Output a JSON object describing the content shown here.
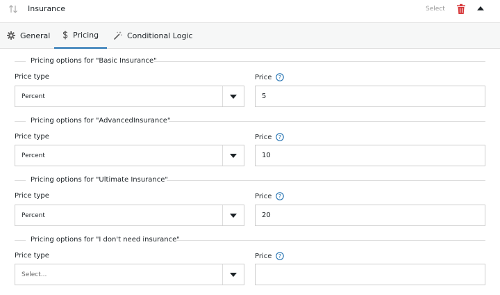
{
  "header": {
    "title": "Insurance",
    "select_label": "Select",
    "icons": {
      "drag": "sort-arrows-icon",
      "delete": "trash-icon",
      "collapse": "caret-up-icon"
    },
    "colors": {
      "delete": "#d63638"
    }
  },
  "tabs": [
    {
      "label": "General",
      "icon": "gear-icon",
      "active": false
    },
    {
      "label": "Pricing",
      "icon": "dollar-icon",
      "active": true
    },
    {
      "label": "Conditional Logic",
      "icon": "magic-wand-icon",
      "active": false
    }
  ],
  "colors": {
    "accent": "#2271b1",
    "tab_bar_bg": "#f6f7f7"
  },
  "pricing_sections": [
    {
      "legend": "Pricing options for \"Basic Insurance\"",
      "price_type_label": "Price type",
      "price_type_value": "Percent",
      "price_label": "Price",
      "price_value": "5"
    },
    {
      "legend": "Pricing options for \"AdvancedInsurance\"",
      "price_type_label": "Price type",
      "price_type_value": "Percent",
      "price_label": "Price",
      "price_value": "10"
    },
    {
      "legend": "Pricing options for \"Ultimate Insurance\"",
      "price_type_label": "Price type",
      "price_type_value": "Percent",
      "price_label": "Price",
      "price_value": "20"
    },
    {
      "legend": "Pricing options for \"I don't need insurance\"",
      "price_type_label": "Price type",
      "price_type_value": "Select...",
      "price_label": "Price",
      "price_value": ""
    }
  ]
}
